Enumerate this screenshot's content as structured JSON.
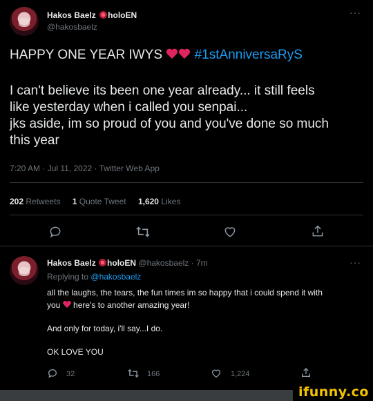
{
  "main_tweet": {
    "author_name": "Hakos Baelz",
    "author_suffix": "holoEN",
    "author_handle": "@hakosbaelz",
    "headline_text": "HAPPY ONE YEAR IWYS",
    "hashtag": "#1stAnniversaRyS",
    "body_lines": [
      "I can't believe its been one year already... it still feels",
      "like yesterday when i called you senpai...",
      "jks aside, im so proud of you and you've done so much",
      "this year"
    ],
    "timestamp": "7:20 AM · Jul 11, 2022 · Twitter Web App",
    "stats": {
      "retweets_count": "202",
      "retweets_label": "Retweets",
      "quotes_count": "1",
      "quotes_label": "Quote Tweet",
      "likes_count": "1,620",
      "likes_label": "Likes"
    },
    "more_label": "···"
  },
  "reply_tweet": {
    "author_name": "Hakos Baelz",
    "author_suffix": "holoEN",
    "author_handle": "@hakosbaelz",
    "age": "· 7m",
    "replying_prefix": "Replying to",
    "replying_handle": "@hakosbaelz",
    "line1": "all the laughs, the tears, the fun times im so happy that i could spend it with",
    "line2_start": "you",
    "line2_end": "here's to another amazing year!",
    "line3": "And only for today, i'll say...I do.",
    "line4": "OK LOVE YOU",
    "replies_count": "32",
    "retweets_count": "166",
    "likes_count": "1,224",
    "more_label": "···"
  },
  "watermark": "ifunny.co",
  "colors": {
    "background": "#000000",
    "accent": "#1d9bf0",
    "heart": "#e0245e",
    "watermark": "#f5c400"
  }
}
